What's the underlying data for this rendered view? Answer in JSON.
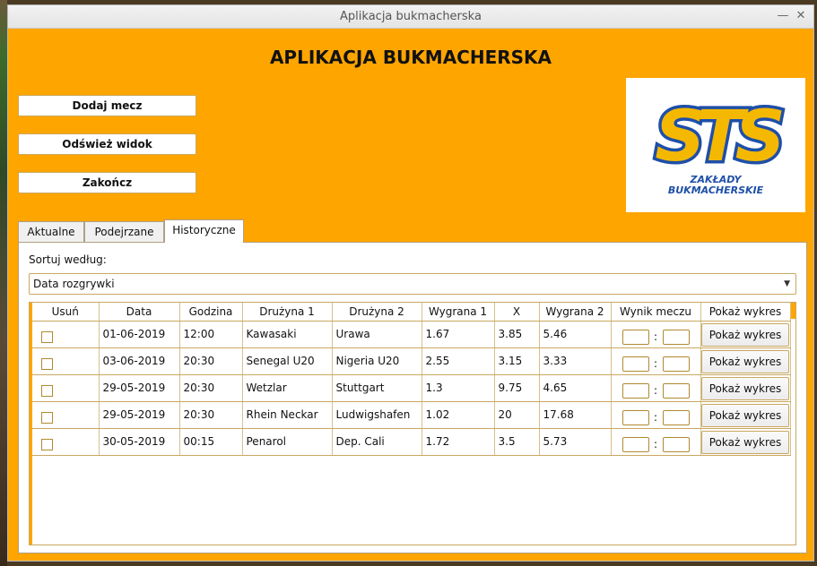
{
  "window": {
    "title": "Aplikacja bukmacherska"
  },
  "app": {
    "heading": "APLIKACJA BUKMACHERSKA"
  },
  "buttons": {
    "add_match": "Dodaj mecz",
    "refresh": "Odśwież widok",
    "exit": "Zakończ"
  },
  "logo": {
    "letters": "STS",
    "line1": "ZAKŁADY",
    "line2": "BUKMACHERSKIE"
  },
  "tabs": [
    {
      "label": "Aktualne",
      "active": false
    },
    {
      "label": "Podejrzane",
      "active": false
    },
    {
      "label": "Historyczne",
      "active": true
    }
  ],
  "sort": {
    "label": "Sortuj według:",
    "selected": "Data rozgrywki"
  },
  "table": {
    "headers": [
      "Usuń",
      "Data",
      "Godzina",
      "Drużyna 1",
      "Drużyna 2",
      "Wygrana 1",
      "X",
      "Wygrana 2",
      "Wynik meczu",
      "Pokaż wykres"
    ],
    "score_separator": ":",
    "chart_button_label": "Pokaż wykres",
    "rows": [
      {
        "data": "01-06-2019",
        "godzina": "12:00",
        "druzyna1": "Kawasaki",
        "druzyna2": "Urawa",
        "wygrana1": "1.67",
        "x": "3.85",
        "wygrana2": "5.46"
      },
      {
        "data": "03-06-2019",
        "godzina": "20:30",
        "druzyna1": "Senegal U20",
        "druzyna2": "Nigeria U20",
        "wygrana1": "2.55",
        "x": "3.15",
        "wygrana2": "3.33"
      },
      {
        "data": "29-05-2019",
        "godzina": "20:30",
        "druzyna1": "Wetzlar",
        "druzyna2": "Stuttgart",
        "wygrana1": "1.3",
        "x": "9.75",
        "wygrana2": "4.65"
      },
      {
        "data": "29-05-2019",
        "godzina": "20:30",
        "druzyna1": "Rhein Neckar",
        "druzyna2": "Ludwigshafen",
        "wygrana1": "1.02",
        "x": "20",
        "wygrana2": "17.68"
      },
      {
        "data": "30-05-2019",
        "godzina": "00:15",
        "druzyna1": "Penarol",
        "druzyna2": "Dep. Cali",
        "wygrana1": "1.72",
        "x": "3.5",
        "wygrana2": "5.73"
      }
    ]
  },
  "colors": {
    "accent": "#ffa500",
    "logo_blue": "#1e4fa8",
    "logo_yellow": "#f5b800"
  }
}
